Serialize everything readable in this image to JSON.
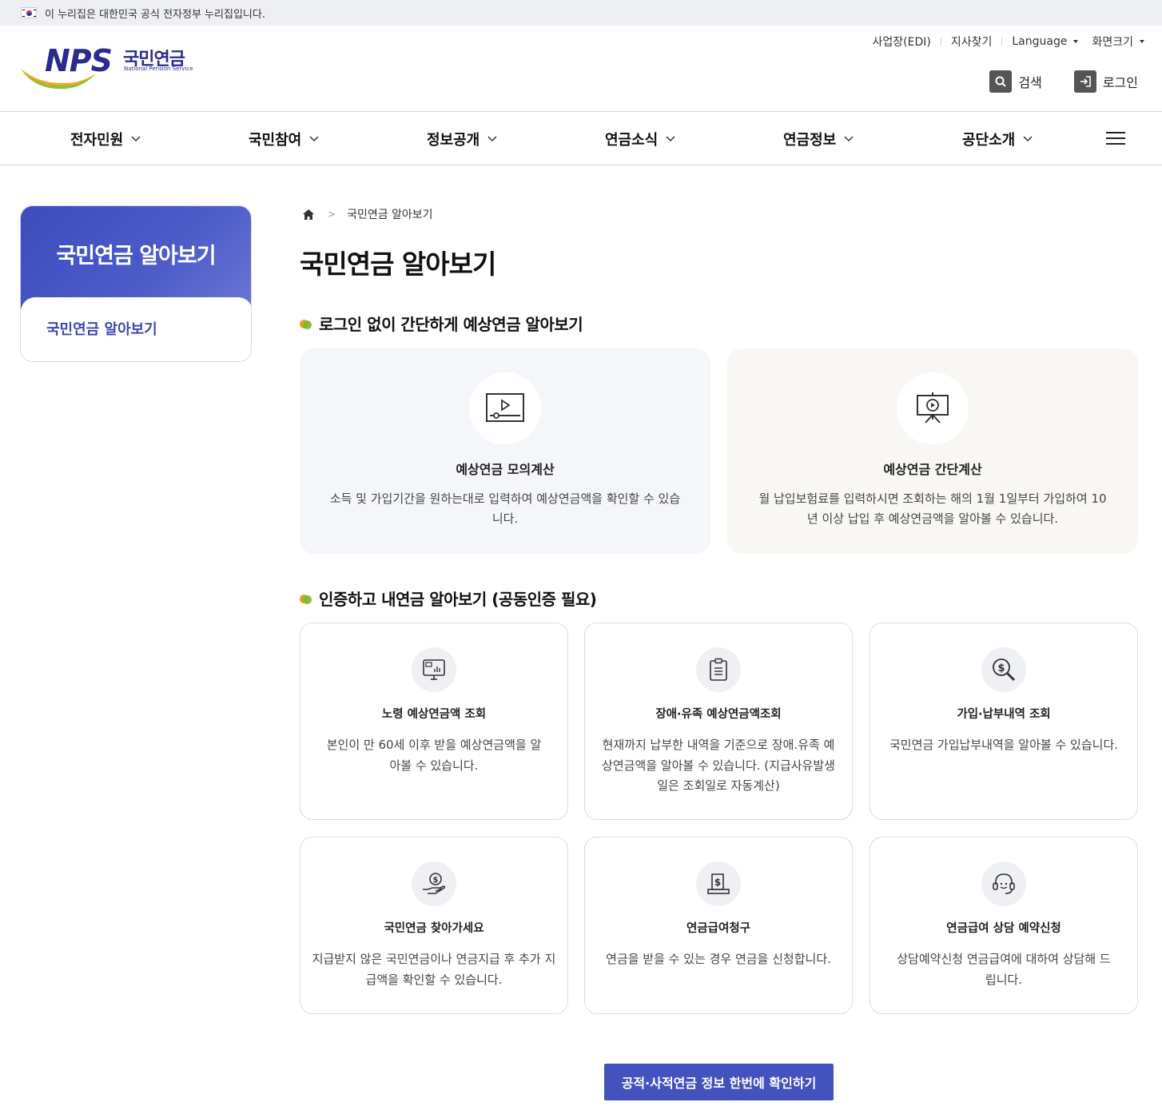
{
  "gov_banner": {
    "text": "이 누리집은 대한민국 공식 전자정부 누리집입니다."
  },
  "logo": {
    "brand": "NPS",
    "name_kr": "국민연금",
    "name_en": "National Pension Service"
  },
  "util_menu": [
    {
      "label": "사업장(EDI)",
      "dropdown": false
    },
    {
      "label": "지사찾기",
      "dropdown": false
    },
    {
      "label": "Language",
      "dropdown": true
    },
    {
      "label": "화면크기",
      "dropdown": true
    }
  ],
  "header_buttons": {
    "search": "검색",
    "login": "로그인"
  },
  "gnb": [
    "전자민원",
    "국민참여",
    "정보공개",
    "연금소식",
    "연금정보",
    "공단소개"
  ],
  "lnb": {
    "title": "국민연금 알아보기",
    "items": [
      "국민연금 알아보기"
    ]
  },
  "breadcrumb": {
    "current": "국민연금 알아보기"
  },
  "page_title": "국민연금 알아보기",
  "section1": {
    "title": "로그인 없이 간단하게 예상연금 알아보기",
    "cards": [
      {
        "icon": "video-play-icon",
        "title": "예상연금 모의계산",
        "desc": "소득 및 가입기간을 원하는대로 입력하여 예상연금액을 확인할 수 있습니다.",
        "bg": "#f5f6f9"
      },
      {
        "icon": "presentation-play-icon",
        "title": "예상연금 간단계산",
        "desc": "월 납입보험료를 입력하시면 조회하는 해의 1월 1일부터 가입하여 10년 이상 납입 후 예상연금액을 알아볼 수 있습니다.",
        "bg": "#f8f7f4"
      }
    ]
  },
  "section2": {
    "title": "인증하고 내연금 알아보기 (공동인증 필요)",
    "cards": [
      {
        "icon": "monitor-chart-icon",
        "title": "노령 예상연금액 조회",
        "desc": "본인이 만 60세 이후 받을 예상연금액을 알아볼 수 있습니다."
      },
      {
        "icon": "clipboard-icon",
        "title": "장애·유족 예상연금액조회",
        "desc": "현재까지 납부한 내역을 기준으로 장애.유족 예상연금액을 알아볼 수 있습니다. (지급사유발생일은 조회일로 자동계산)"
      },
      {
        "icon": "search-dollar-icon",
        "title": "가입·납부내역 조회",
        "desc": "국민연금 가입납부내역을 알아볼 수 있습니다."
      },
      {
        "icon": "hand-coin-icon",
        "title": "국민연금 찾아가세요",
        "desc": "지급받지 않은 국민연금이나 연금지급 후 추가 지급액을 확인할 수 있습니다."
      },
      {
        "icon": "document-dollar-icon",
        "title": "연금급여청구",
        "desc": "연금을 받을 수 있는 경우 연금을 신청합니다."
      },
      {
        "icon": "headset-icon",
        "title": "연금급여 상담 예약신청",
        "desc": "상담예약신청 연금급여에 대하여 상담해 드립니다."
      }
    ]
  },
  "cta_button": "공적·사적연금 정보 한번에 확인하기",
  "colors": {
    "primary": "#4352bd",
    "brand": "#2b2a8f",
    "bullet_green": "#7cb82f",
    "bullet_orange": "#f39a1e"
  }
}
